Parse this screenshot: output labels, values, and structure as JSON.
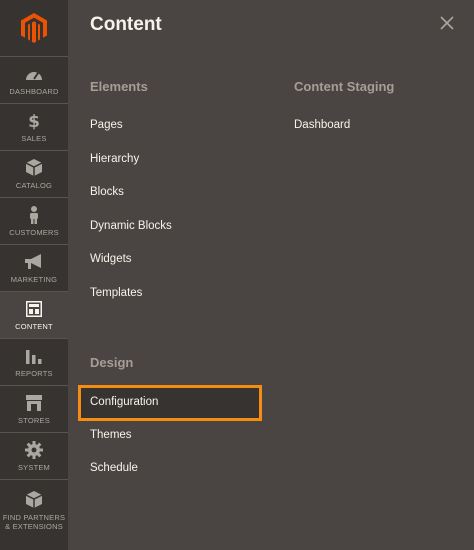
{
  "sidebar": {
    "items": [
      {
        "id": "dashboard",
        "label": "DASHBOARD",
        "icon": "speedometer-icon",
        "active": false
      },
      {
        "id": "sales",
        "label": "SALES",
        "icon": "dollar-icon",
        "active": false
      },
      {
        "id": "catalog",
        "label": "CATALOG",
        "icon": "box-icon",
        "active": false
      },
      {
        "id": "customers",
        "label": "CUSTOMERS",
        "icon": "person-icon",
        "active": false
      },
      {
        "id": "marketing",
        "label": "MARKETING",
        "icon": "megaphone-icon",
        "active": false
      },
      {
        "id": "content",
        "label": "CONTENT",
        "icon": "layout-icon",
        "active": true
      },
      {
        "id": "reports",
        "label": "REPORTS",
        "icon": "bar-chart-icon",
        "active": false
      },
      {
        "id": "stores",
        "label": "STORES",
        "icon": "storefront-icon",
        "active": false
      },
      {
        "id": "system",
        "label": "SYSTEM",
        "icon": "gear-icon",
        "active": false
      },
      {
        "id": "partners",
        "label": "FIND PARTNERS & EXTENSIONS",
        "icon": "cube-icon",
        "active": false
      }
    ]
  },
  "panel": {
    "title": "Content",
    "elements": {
      "title": "Elements",
      "links": [
        "Pages",
        "Hierarchy",
        "Blocks",
        "Dynamic Blocks",
        "Widgets",
        "Templates"
      ]
    },
    "staging": {
      "title": "Content Staging",
      "links": [
        "Dashboard"
      ]
    },
    "design": {
      "title": "Design",
      "links": [
        "Configuration",
        "Themes",
        "Schedule"
      ]
    }
  },
  "colors": {
    "accent": "#f68d13",
    "brand_logo": "#eb5202",
    "panel_bg": "#4a4542",
    "sidebar_bg": "#373330"
  }
}
